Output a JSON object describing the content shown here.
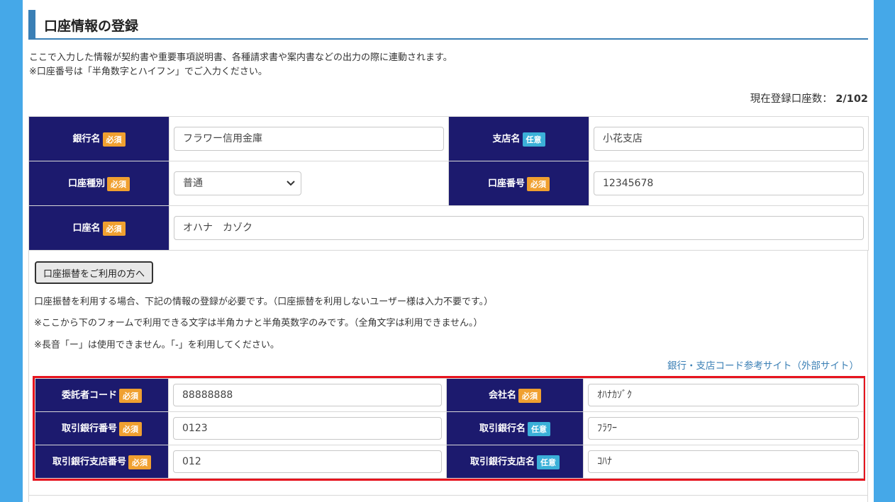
{
  "page": {
    "title": "口座情報の登録",
    "intro": [
      "ここで入力した情報が契約書や重要事項説明書、各種請求書や案内書などの出力の際に連動されます。",
      "※口座番号は「半角数字とハイフン」でご入力ください。"
    ],
    "count_label": "現在登録口座数：",
    "count_value": "2/102"
  },
  "badges": {
    "required": "必須",
    "optional": "任意"
  },
  "account": {
    "bank_name": {
      "label": "銀行名",
      "value": "フラワー信用金庫"
    },
    "branch_name": {
      "label": "支店名",
      "value": "小花支店"
    },
    "account_type": {
      "label": "口座種別",
      "value": "普通"
    },
    "account_number": {
      "label": "口座番号",
      "value": "12345678"
    },
    "account_holder": {
      "label": "口座名",
      "value": "オハナ　カゾク"
    }
  },
  "transfer": {
    "button": "口座振替をご利用の方へ",
    "notes": [
      "口座振替を利用する場合、下記の情報の登録が必要です。（口座振替を利用しないユーザー様は入力不要です。）",
      "※ここから下のフォームで利用できる文字は半角カナと半角英数字のみです。（全角文字は利用できません。）",
      "※長音「ー」は使用できません。「-」を利用してください。"
    ],
    "link": "銀行・支店コード参考サイト（外部サイト）",
    "consignor_code": {
      "label": "委託者コード",
      "value": "88888888"
    },
    "company_name": {
      "label": "会社名",
      "value": "ｵﾊﾅｶｿﾞｸ"
    },
    "bank_number": {
      "label": "取引銀行番号",
      "value": "0123"
    },
    "bank_name": {
      "label": "取引銀行名",
      "value": "ﾌﾗﾜｰ"
    },
    "branch_number": {
      "label": "取引銀行支店番号",
      "value": "012"
    },
    "branch_name": {
      "label": "取引銀行支店名",
      "value": "ｺﾊﾅ"
    }
  }
}
